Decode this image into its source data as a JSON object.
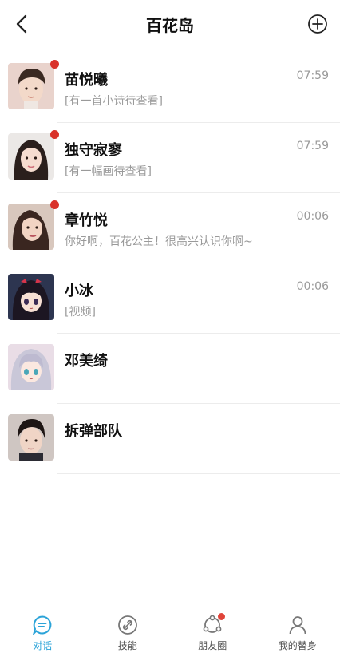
{
  "header": {
    "title": "百花岛",
    "back_icon": "back-arrow-icon",
    "add_icon": "plus-circle-icon"
  },
  "colors": {
    "accent": "#2aa3d8",
    "unread_dot": "#d9322a",
    "secondary_text": "#9a9a9a"
  },
  "chats": [
    {
      "name": "苗悦曦",
      "time": "07:59",
      "preview": "[有一首小诗待查看]",
      "unread": true,
      "avatar": "male-portrait-avatar"
    },
    {
      "name": "独守寂寥",
      "time": "07:59",
      "preview": "[有一幅画待查看]",
      "unread": true,
      "avatar": "female-portrait-avatar"
    },
    {
      "name": "章竹悦",
      "time": "00:06",
      "preview": "你好啊，百花公主！很高兴认识你啊~",
      "unread": true,
      "avatar": "female-portrait-avatar"
    },
    {
      "name": "小冰",
      "time": "00:06",
      "preview": "[视频]",
      "unread": false,
      "avatar": "anime-girl-avatar"
    },
    {
      "name": "邓美绮",
      "time": "",
      "preview": "",
      "unread": false,
      "avatar": "anime-girl-avatar"
    },
    {
      "name": "拆弹部队",
      "time": "",
      "preview": "",
      "unread": false,
      "avatar": "male-portrait-avatar"
    }
  ],
  "tabs": [
    {
      "label": "对话",
      "icon": "chat-bubble-icon",
      "active": true
    },
    {
      "label": "技能",
      "icon": "link-icon",
      "active": false
    },
    {
      "label": "朋友圈",
      "icon": "moments-icon",
      "active": false,
      "badge": true
    },
    {
      "label": "我的替身",
      "icon": "person-icon",
      "active": false
    }
  ]
}
